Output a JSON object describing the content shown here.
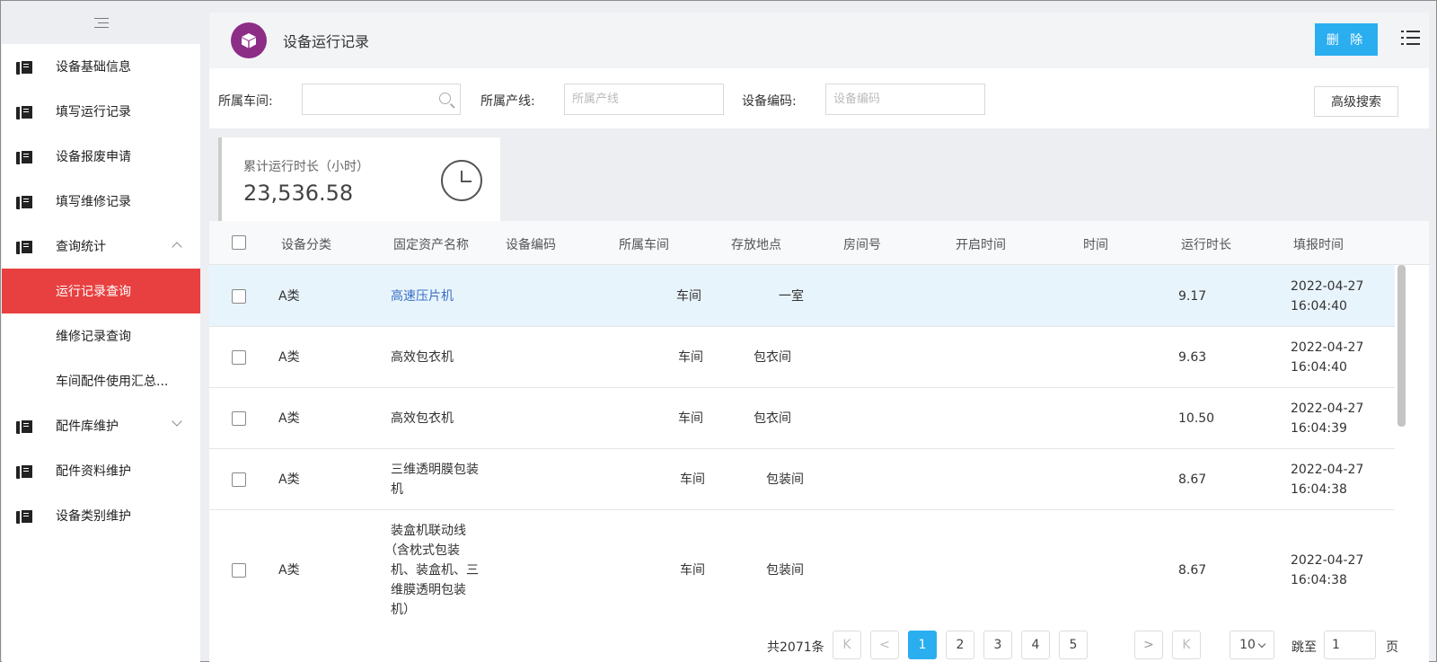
{
  "sidebar": {
    "items": [
      {
        "label": "设备基础信息"
      },
      {
        "label": "填写运行记录"
      },
      {
        "label": "设备报废申请"
      },
      {
        "label": "填写维修记录"
      },
      {
        "label": "查询统计"
      },
      {
        "label": "运行记录查询"
      },
      {
        "label": "维修记录查询"
      },
      {
        "label": "车间配件使用汇总..."
      },
      {
        "label": "配件库维护"
      },
      {
        "label": "配件资料维护"
      },
      {
        "label": "设备类别维护"
      }
    ]
  },
  "header": {
    "title": "设备运行记录",
    "delete_label": "删 除"
  },
  "filter": {
    "workshop_label": "所属车间:",
    "line_label": "所属产线:",
    "line_placeholder": "所属产线",
    "code_label": "设备编码:",
    "code_placeholder": "设备编码",
    "advanced_label": "高级搜索"
  },
  "stat": {
    "label": "累计运行时长（小时）",
    "value": "23,536.58"
  },
  "table": {
    "columns": [
      "设备分类",
      "固定资产名称",
      "设备编码",
      "所属车间",
      "存放地点",
      "房间号",
      "开启时间",
      "时间",
      "运行时长",
      "填报时间"
    ],
    "rows": [
      {
        "category": "A类",
        "name": "高速压片机",
        "workshop": "车间",
        "location": "一室",
        "duration": "9.17",
        "date": "2022-04-27",
        "time": "16:04:40"
      },
      {
        "category": "A类",
        "name": "高效包衣机",
        "workshop": "车间",
        "location": "包衣间",
        "duration": "9.63",
        "date": "2022-04-27",
        "time": "16:04:40"
      },
      {
        "category": "A类",
        "name": "高效包衣机",
        "workshop": "车间",
        "location": "包衣间",
        "duration": "10.50",
        "date": "2022-04-27",
        "time": "16:04:39"
      },
      {
        "category": "A类",
        "name_lines": [
          "三维透明膜包装",
          "机"
        ],
        "workshop": "车间",
        "location": "包装间",
        "duration": "8.67",
        "date": "2022-04-27",
        "time": "16:04:38"
      },
      {
        "category": "A类",
        "name_lines": [
          "装盒机联动线",
          "（含枕式包装",
          "机、装盒机、三",
          "维膜透明包装",
          "机）"
        ],
        "workshop": "车间",
        "location": "包装间",
        "duration": "8.67",
        "date": "2022-04-27",
        "time": "16:04:38"
      }
    ]
  },
  "pagination": {
    "total": "共2071条",
    "pages": [
      "1",
      "2",
      "3",
      "4",
      "5"
    ],
    "first": "K",
    "prev": "<",
    "next": ">",
    "last": "K",
    "page_size": "10",
    "jump_label": "跳至",
    "jump_value": "1",
    "page_unit": "页"
  }
}
